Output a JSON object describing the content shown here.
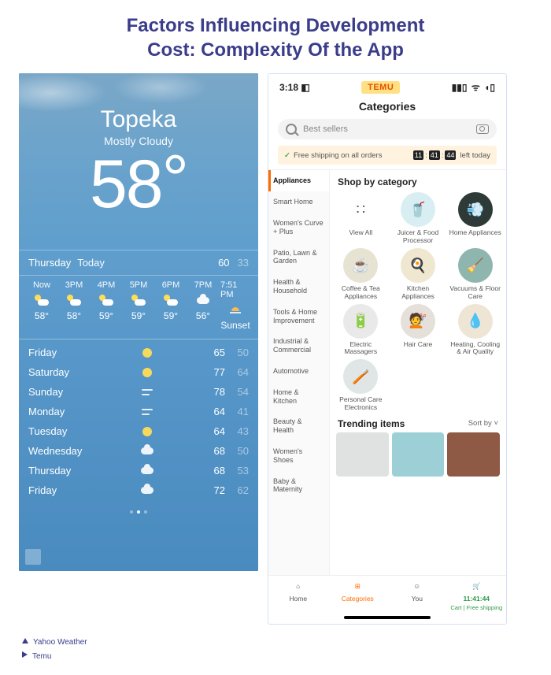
{
  "title_line1": "Factors Influencing Development",
  "title_line2": "Cost: Complexity Of the App",
  "legend": {
    "a": "Yahoo Weather",
    "b": "Temu"
  },
  "weather": {
    "city": "Topeka",
    "condition": "Mostly Cloudy",
    "current_temp": "58",
    "today": {
      "day": "Thursday",
      "label": "Today",
      "hi": "60",
      "lo": "33"
    },
    "hours": [
      {
        "label": "Now",
        "icon": "pcloud",
        "temp": "58°"
      },
      {
        "label": "3PM",
        "icon": "pcloud",
        "temp": "58°"
      },
      {
        "label": "4PM",
        "icon": "pcloud",
        "temp": "59°"
      },
      {
        "label": "5PM",
        "icon": "pcloud",
        "temp": "59°"
      },
      {
        "label": "6PM",
        "icon": "pcloud",
        "temp": "59°"
      },
      {
        "label": "7PM",
        "icon": "cloud",
        "temp": "56°"
      },
      {
        "label": "7:51 PM",
        "icon": "sunset",
        "temp": "Sunset"
      }
    ],
    "days": [
      {
        "name": "Friday",
        "icon": "sun",
        "hi": "65",
        "lo": "50"
      },
      {
        "name": "Saturday",
        "icon": "sun",
        "hi": "77",
        "lo": "64"
      },
      {
        "name": "Sunday",
        "icon": "wind",
        "hi": "78",
        "lo": "54"
      },
      {
        "name": "Monday",
        "icon": "wind",
        "hi": "64",
        "lo": "41"
      },
      {
        "name": "Tuesday",
        "icon": "sun",
        "hi": "64",
        "lo": "43"
      },
      {
        "name": "Wednesday",
        "icon": "cloud",
        "hi": "68",
        "lo": "50"
      },
      {
        "name": "Thursday",
        "icon": "cloud",
        "hi": "68",
        "lo": "53"
      },
      {
        "name": "Friday",
        "icon": "cloud",
        "hi": "72",
        "lo": "62"
      }
    ]
  },
  "temu": {
    "status_time": "3:18",
    "logo": "TEMU",
    "header": "Categories",
    "search_placeholder": "Best sellers",
    "ship_text": "Free shipping on all orders",
    "ship_countdown": [
      "11",
      "41",
      "44"
    ],
    "ship_suffix": "left today",
    "side_items": [
      "Appliances",
      "Smart Home",
      "Women's Curve + Plus",
      "Patio, Lawn & Garden",
      "Health & Household",
      "Tools & Home Improvement",
      "Industrial & Commercial",
      "Automotive",
      "Home & Kitchen",
      "Beauty & Health",
      "Women's Shoes",
      "Baby & Maternity"
    ],
    "side_selected_index": 0,
    "section_title": "Shop by category",
    "categories": [
      {
        "label": "View All",
        "bg": "#ffffff",
        "glyph": "∷"
      },
      {
        "label": "Juicer & Food Processor",
        "bg": "#d9eef2",
        "glyph": "🥤"
      },
      {
        "label": "Home Appliances",
        "bg": "#2d3a37",
        "glyph": "💨"
      },
      {
        "label": "Coffee & Tea Appliances",
        "bg": "#e7e3d3",
        "glyph": "☕"
      },
      {
        "label": "Kitchen Appliances",
        "bg": "#efe7cf",
        "glyph": "🍳"
      },
      {
        "label": "Vacuums & Floor Care",
        "bg": "#8fb5af",
        "glyph": "🧹"
      },
      {
        "label": "Electric Massagers",
        "bg": "#e9e9e9",
        "glyph": "🔋"
      },
      {
        "label": "Hair Care",
        "bg": "#e5e0da",
        "glyph": "💇"
      },
      {
        "label": "Heating, Cooling & Air Quality",
        "bg": "#efe5d5",
        "glyph": "💧"
      },
      {
        "label": "Personal Care Electronics",
        "bg": "#dfe6e5",
        "glyph": "🪥"
      }
    ],
    "trending_title": "Trending items",
    "sort_label": "Sort by",
    "trending_colors": [
      "#dfe2e0",
      "#9ccfd6",
      "#8e5a45"
    ],
    "nav": {
      "home": "Home",
      "categories": "Categories",
      "you": "You",
      "cart": "Cart",
      "cart_sub": "Free shipping",
      "cart_timer": "11:41:44"
    }
  }
}
